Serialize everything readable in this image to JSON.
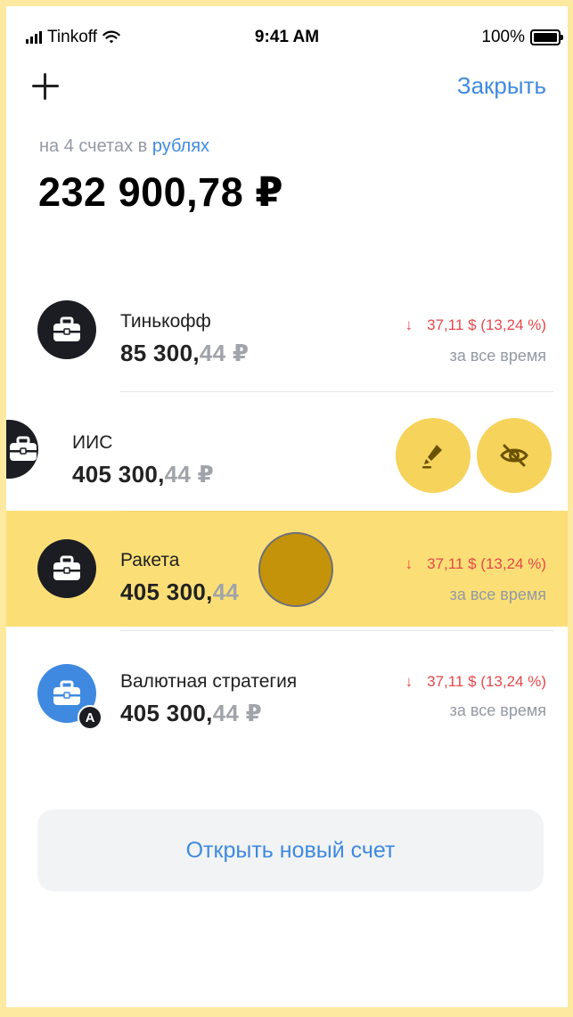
{
  "status_bar": {
    "carrier": "Tinkoff",
    "time": "9:41 AM",
    "battery": "100%"
  },
  "header": {
    "add_icon": "plus-icon",
    "close_label": "Закрыть"
  },
  "summary": {
    "caption_prefix": "на 4 счетах в",
    "currency_link": "рублях",
    "total": "232 900,78 ₽"
  },
  "accounts": [
    {
      "name": "Тинькофф",
      "amount_int": "85 300,",
      "amount_frac": "44 ₽",
      "change": "37,11 $  (13,24 %)",
      "period": "за все время",
      "icon": "briefcase-icon",
      "color": "#1b1d23"
    },
    {
      "name": "ИИС",
      "amount_int": "405 300,",
      "amount_frac": "44 ₽",
      "icon": "briefcase-icon",
      "color": "#1b1d23",
      "actions": [
        "edit-icon",
        "hide-eye-icon"
      ]
    },
    {
      "name": "Ракета",
      "amount_int": "405 300,",
      "amount_frac": "44",
      "change": "37,11 $  (13,24 %)",
      "period": "за все время",
      "icon": "briefcase-icon",
      "color": "#1b1d23"
    },
    {
      "name": "Валютная стратегия",
      "amount_int": "405 300,",
      "amount_frac": "44 ₽",
      "change": "37,11 $  (13,24 %)",
      "period": "за все время",
      "icon": "briefcase-icon",
      "color": "#3f8ae0",
      "badge": "A"
    }
  ],
  "open_account_label": "Открыть новый счет",
  "colors": {
    "accent_blue": "#3f8ae0",
    "negative_red": "#e5484d",
    "highlight_yellow": "#f6d35b"
  }
}
